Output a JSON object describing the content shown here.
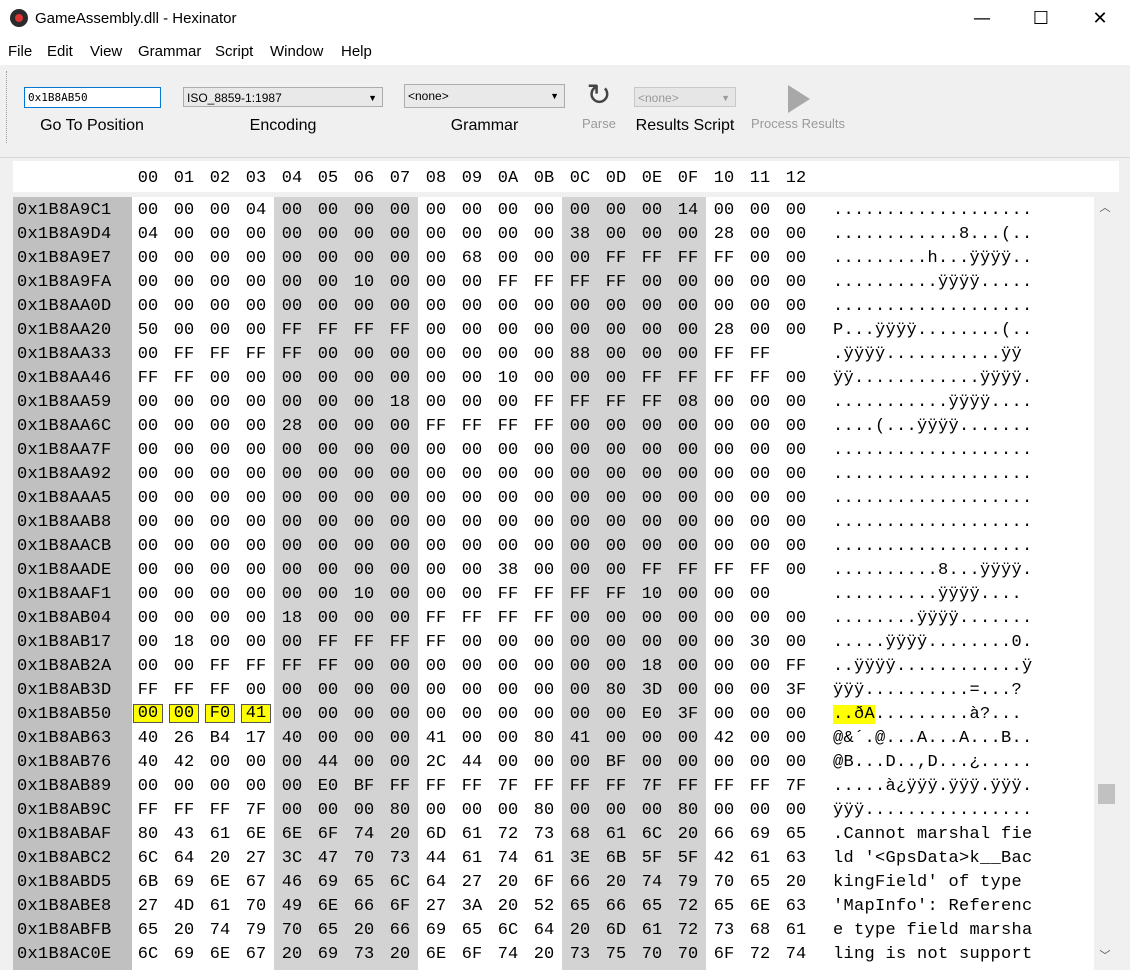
{
  "window": {
    "title": "GameAssembly.dll - Hexinator",
    "minimize": "—",
    "maximize": "☐",
    "close": "✕"
  },
  "menu": [
    "File",
    "Edit",
    "View",
    "Grammar",
    "Script",
    "Window",
    "Help"
  ],
  "toolbar": {
    "goto_value": "0x1B8AB50",
    "goto_label": "Go To Position",
    "encoding_value": "ISO_8859-1:1987",
    "encoding_label": "Encoding",
    "grammar_value": "<none>",
    "grammar_label": "Grammar",
    "parse_label": "Parse",
    "results_value": "<none>",
    "results_label": "Results Script",
    "process_label": "Process Results"
  },
  "colors": {
    "highlight": "#ffff00",
    "address_bg": "#c0c0c0",
    "band_bg": "#d3d3d3"
  },
  "icons": {
    "parse": "refresh-icon",
    "process": "play-icon"
  },
  "columns": [
    "00",
    "01",
    "02",
    "03",
    "04",
    "05",
    "06",
    "07",
    "08",
    "09",
    "0A",
    "0B",
    "0C",
    "0D",
    "0E",
    "0F",
    "10",
    "11",
    "12"
  ],
  "rows": [
    {
      "addr": "0x1B8A9C1",
      "bytes": [
        "00",
        "00",
        "00",
        "04",
        "00",
        "00",
        "00",
        "00",
        "00",
        "00",
        "00",
        "00",
        "00",
        "00",
        "00",
        "14",
        "00",
        "00",
        "00"
      ],
      "ascii": "..................."
    },
    {
      "addr": "0x1B8A9D4",
      "bytes": [
        "04",
        "00",
        "00",
        "00",
        "00",
        "00",
        "00",
        "00",
        "00",
        "00",
        "00",
        "00",
        "38",
        "00",
        "00",
        "00",
        "28",
        "00",
        "00"
      ],
      "ascii": "............8...(.."
    },
    {
      "addr": "0x1B8A9E7",
      "bytes": [
        "00",
        "00",
        "00",
        "00",
        "00",
        "00",
        "00",
        "00",
        "00",
        "68",
        "00",
        "00",
        "00",
        "FF",
        "FF",
        "FF",
        "FF",
        "00",
        "00"
      ],
      "ascii": ".........h...ÿÿÿÿ.."
    },
    {
      "addr": "0x1B8A9FA",
      "bytes": [
        "00",
        "00",
        "00",
        "00",
        "00",
        "00",
        "10",
        "00",
        "00",
        "00",
        "FF",
        "FF",
        "FF",
        "FF",
        "00",
        "00",
        "00",
        "00",
        "00"
      ],
      "ascii": "..........ÿÿÿÿ....."
    },
    {
      "addr": "0x1B8AA0D",
      "bytes": [
        "00",
        "00",
        "00",
        "00",
        "00",
        "00",
        "00",
        "00",
        "00",
        "00",
        "00",
        "00",
        "00",
        "00",
        "00",
        "00",
        "00",
        "00",
        "00"
      ],
      "ascii": "..................."
    },
    {
      "addr": "0x1B8AA20",
      "bytes": [
        "50",
        "00",
        "00",
        "00",
        "FF",
        "FF",
        "FF",
        "FF",
        "00",
        "00",
        "00",
        "00",
        "00",
        "00",
        "00",
        "00",
        "28",
        "00",
        "00"
      ],
      "ascii": "P...ÿÿÿÿ........(.."
    },
    {
      "addr": "0x1B8AA33",
      "bytes": [
        "00",
        "FF",
        "FF",
        "FF",
        "FF",
        "00",
        "00",
        "00",
        "00",
        "00",
        "00",
        "00",
        "88",
        "00",
        "00",
        "00",
        "FF",
        "FF"
      ],
      "ascii": ".ÿÿÿÿ...........ÿÿ"
    },
    {
      "addr": "0x1B8AA46",
      "bytes": [
        "FF",
        "FF",
        "00",
        "00",
        "00",
        "00",
        "00",
        "00",
        "00",
        "00",
        "10",
        "00",
        "00",
        "00",
        "FF",
        "FF",
        "FF",
        "FF",
        "00"
      ],
      "ascii": "ÿÿ............ÿÿÿÿ."
    },
    {
      "addr": "0x1B8AA59",
      "bytes": [
        "00",
        "00",
        "00",
        "00",
        "00",
        "00",
        "00",
        "18",
        "00",
        "00",
        "00",
        "FF",
        "FF",
        "FF",
        "FF",
        "08",
        "00",
        "00",
        "00"
      ],
      "ascii": "...........ÿÿÿÿ...."
    },
    {
      "addr": "0x1B8AA6C",
      "bytes": [
        "00",
        "00",
        "00",
        "00",
        "28",
        "00",
        "00",
        "00",
        "FF",
        "FF",
        "FF",
        "FF",
        "00",
        "00",
        "00",
        "00",
        "00",
        "00",
        "00"
      ],
      "ascii": "....(...ÿÿÿÿ......."
    },
    {
      "addr": "0x1B8AA7F",
      "bytes": [
        "00",
        "00",
        "00",
        "00",
        "00",
        "00",
        "00",
        "00",
        "00",
        "00",
        "00",
        "00",
        "00",
        "00",
        "00",
        "00",
        "00",
        "00",
        "00"
      ],
      "ascii": "..................."
    },
    {
      "addr": "0x1B8AA92",
      "bytes": [
        "00",
        "00",
        "00",
        "00",
        "00",
        "00",
        "00",
        "00",
        "00",
        "00",
        "00",
        "00",
        "00",
        "00",
        "00",
        "00",
        "00",
        "00",
        "00"
      ],
      "ascii": "..................."
    },
    {
      "addr": "0x1B8AAA5",
      "bytes": [
        "00",
        "00",
        "00",
        "00",
        "00",
        "00",
        "00",
        "00",
        "00",
        "00",
        "00",
        "00",
        "00",
        "00",
        "00",
        "00",
        "00",
        "00",
        "00"
      ],
      "ascii": "..................."
    },
    {
      "addr": "0x1B8AAB8",
      "bytes": [
        "00",
        "00",
        "00",
        "00",
        "00",
        "00",
        "00",
        "00",
        "00",
        "00",
        "00",
        "00",
        "00",
        "00",
        "00",
        "00",
        "00",
        "00",
        "00"
      ],
      "ascii": "..................."
    },
    {
      "addr": "0x1B8AACB",
      "bytes": [
        "00",
        "00",
        "00",
        "00",
        "00",
        "00",
        "00",
        "00",
        "00",
        "00",
        "00",
        "00",
        "00",
        "00",
        "00",
        "00",
        "00",
        "00",
        "00"
      ],
      "ascii": "..................."
    },
    {
      "addr": "0x1B8AADE",
      "bytes": [
        "00",
        "00",
        "00",
        "00",
        "00",
        "00",
        "00",
        "00",
        "00",
        "00",
        "38",
        "00",
        "00",
        "00",
        "FF",
        "FF",
        "FF",
        "FF",
        "00"
      ],
      "ascii": "..........8...ÿÿÿÿ."
    },
    {
      "addr": "0x1B8AAF1",
      "bytes": [
        "00",
        "00",
        "00",
        "00",
        "00",
        "00",
        "10",
        "00",
        "00",
        "00",
        "FF",
        "FF",
        "FF",
        "FF",
        "10",
        "00",
        "00",
        "00"
      ],
      "ascii": "..........ÿÿÿÿ...."
    },
    {
      "addr": "0x1B8AB04",
      "bytes": [
        "00",
        "00",
        "00",
        "00",
        "18",
        "00",
        "00",
        "00",
        "FF",
        "FF",
        "FF",
        "FF",
        "00",
        "00",
        "00",
        "00",
        "00",
        "00",
        "00"
      ],
      "ascii": "........ÿÿÿÿ......."
    },
    {
      "addr": "0x1B8AB17",
      "bytes": [
        "00",
        "18",
        "00",
        "00",
        "00",
        "FF",
        "FF",
        "FF",
        "FF",
        "00",
        "00",
        "00",
        "00",
        "00",
        "00",
        "00",
        "00",
        "30",
        "00"
      ],
      "ascii": ".....ÿÿÿÿ........0."
    },
    {
      "addr": "0x1B8AB2A",
      "bytes": [
        "00",
        "00",
        "FF",
        "FF",
        "FF",
        "FF",
        "00",
        "00",
        "00",
        "00",
        "00",
        "00",
        "00",
        "00",
        "18",
        "00",
        "00",
        "00",
        "FF"
      ],
      "ascii": "..ÿÿÿÿ............ÿ"
    },
    {
      "addr": "0x1B8AB3D",
      "bytes": [
        "FF",
        "FF",
        "FF",
        "00",
        "00",
        "00",
        "00",
        "00",
        "00",
        "00",
        "00",
        "00",
        "00",
        "80",
        "3D",
        "00",
        "00",
        "00",
        "3F"
      ],
      "ascii": "ÿÿÿ..........=...?"
    },
    {
      "addr": "0x1B8AB50",
      "bytes": [
        "00",
        "00",
        "F0",
        "41",
        "00",
        "00",
        "00",
        "00",
        "00",
        "00",
        "00",
        "00",
        "00",
        "00",
        "E0",
        "3F",
        "00",
        "00",
        "00"
      ],
      "ascii": "..ðA.........à?...",
      "hl_bytes": 4,
      "hl_chars": 4
    },
    {
      "addr": "0x1B8AB63",
      "bytes": [
        "40",
        "26",
        "B4",
        "17",
        "40",
        "00",
        "00",
        "00",
        "41",
        "00",
        "00",
        "80",
        "41",
        "00",
        "00",
        "00",
        "42",
        "00",
        "00"
      ],
      "ascii": "@&´.@...A...A...B.."
    },
    {
      "addr": "0x1B8AB76",
      "bytes": [
        "40",
        "42",
        "00",
        "00",
        "00",
        "44",
        "00",
        "00",
        "2C",
        "44",
        "00",
        "00",
        "00",
        "BF",
        "00",
        "00",
        "00",
        "00",
        "00"
      ],
      "ascii": "@B...D..,D...¿....."
    },
    {
      "addr": "0x1B8AB89",
      "bytes": [
        "00",
        "00",
        "00",
        "00",
        "00",
        "E0",
        "BF",
        "FF",
        "FF",
        "FF",
        "7F",
        "FF",
        "FF",
        "FF",
        "7F",
        "FF",
        "FF",
        "FF",
        "7F"
      ],
      "ascii": ".....à¿ÿÿÿ.ÿÿÿ.ÿÿÿ."
    },
    {
      "addr": "0x1B8AB9C",
      "bytes": [
        "FF",
        "FF",
        "FF",
        "7F",
        "00",
        "00",
        "00",
        "80",
        "00",
        "00",
        "00",
        "80",
        "00",
        "00",
        "00",
        "80",
        "00",
        "00",
        "00"
      ],
      "ascii": "ÿÿÿ................"
    },
    {
      "addr": "0x1B8ABAF",
      "bytes": [
        "80",
        "43",
        "61",
        "6E",
        "6E",
        "6F",
        "74",
        "20",
        "6D",
        "61",
        "72",
        "73",
        "68",
        "61",
        "6C",
        "20",
        "66",
        "69",
        "65"
      ],
      "ascii": ".Cannot marshal fie"
    },
    {
      "addr": "0x1B8ABC2",
      "bytes": [
        "6C",
        "64",
        "20",
        "27",
        "3C",
        "47",
        "70",
        "73",
        "44",
        "61",
        "74",
        "61",
        "3E",
        "6B",
        "5F",
        "5F",
        "42",
        "61",
        "63"
      ],
      "ascii": "ld '<GpsData>k__Bac"
    },
    {
      "addr": "0x1B8ABD5",
      "bytes": [
        "6B",
        "69",
        "6E",
        "67",
        "46",
        "69",
        "65",
        "6C",
        "64",
        "27",
        "20",
        "6F",
        "66",
        "20",
        "74",
        "79",
        "70",
        "65",
        "20"
      ],
      "ascii": "kingField' of type "
    },
    {
      "addr": "0x1B8ABE8",
      "bytes": [
        "27",
        "4D",
        "61",
        "70",
        "49",
        "6E",
        "66",
        "6F",
        "27",
        "3A",
        "20",
        "52",
        "65",
        "66",
        "65",
        "72",
        "65",
        "6E",
        "63"
      ],
      "ascii": "'MapInfo': Referenc"
    },
    {
      "addr": "0x1B8ABFB",
      "bytes": [
        "65",
        "20",
        "74",
        "79",
        "70",
        "65",
        "20",
        "66",
        "69",
        "65",
        "6C",
        "64",
        "20",
        "6D",
        "61",
        "72",
        "73",
        "68",
        "61"
      ],
      "ascii": "e type field marsha"
    },
    {
      "addr": "0x1B8AC0E",
      "bytes": [
        "6C",
        "69",
        "6E",
        "67",
        "20",
        "69",
        "73",
        "20",
        "6E",
        "6F",
        "74",
        "20",
        "73",
        "75",
        "70",
        "70",
        "6F",
        "72",
        "74"
      ],
      "ascii": "ling is not support"
    }
  ]
}
